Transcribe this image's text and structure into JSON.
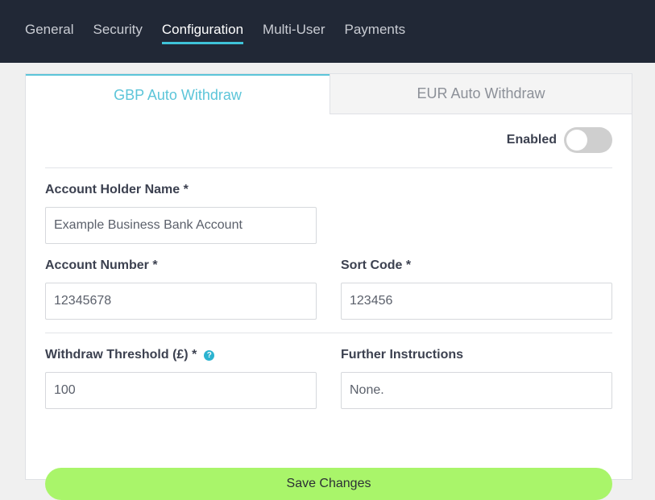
{
  "nav": {
    "items": [
      {
        "label": "General"
      },
      {
        "label": "Security"
      },
      {
        "label": "Configuration"
      },
      {
        "label": "Multi-User"
      },
      {
        "label": "Payments"
      }
    ],
    "active": "Configuration"
  },
  "tabs": {
    "gbp": "GBP Auto Withdraw",
    "eur": "EUR Auto Withdraw",
    "active": "gbp"
  },
  "toggle": {
    "label": "Enabled",
    "state": "off"
  },
  "form": {
    "account_holder": {
      "label": "Account Holder Name *",
      "value": "Example Business Bank Account"
    },
    "account_number": {
      "label": "Account Number *",
      "value": "12345678"
    },
    "sort_code": {
      "label": "Sort Code *",
      "value": "123456"
    },
    "withdraw_threshold": {
      "label": "Withdraw Threshold (£) *",
      "value": "100"
    },
    "further_instructions": {
      "label": "Further Instructions",
      "value": "None."
    }
  },
  "save_label": "Save Changes",
  "icons": {
    "help": "?"
  },
  "colors": {
    "nav_bg": "#212836",
    "accent": "#5cc5d9",
    "save_button": "#a9f56a",
    "toggle_off": "#cfcfcf"
  }
}
